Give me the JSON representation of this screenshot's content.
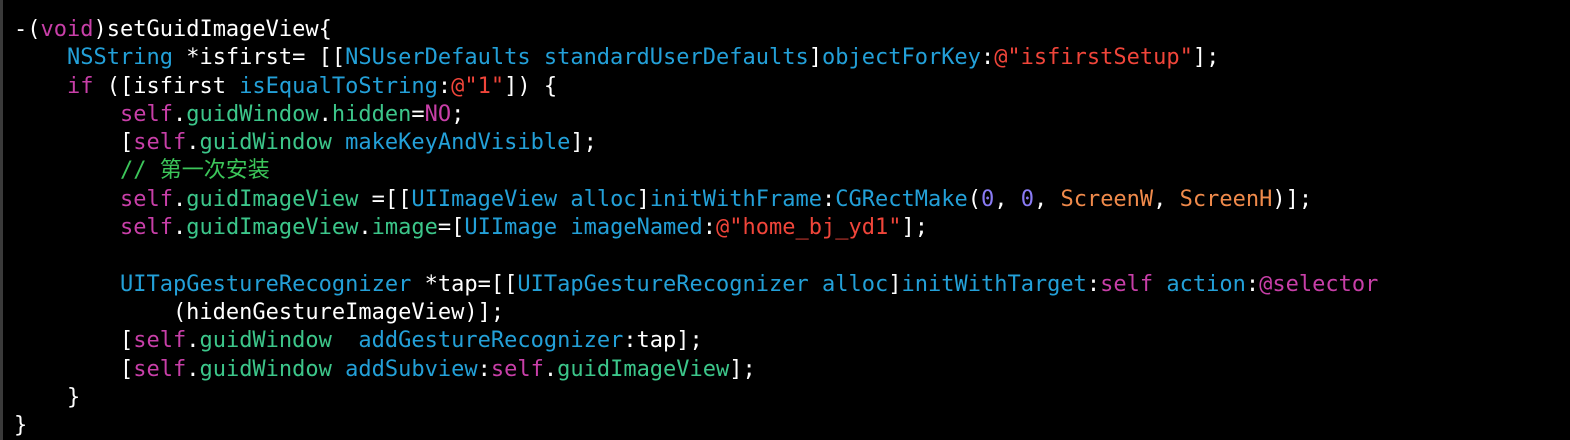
{
  "colors": {
    "background": "#000000",
    "plain": "#ffffff",
    "keyword": "#c83fa8",
    "type": "#23a0d8",
    "property": "#3cc68a",
    "string": "#f0453a",
    "number": "#8a7bf5",
    "macro": "#f08a4b",
    "comment": "#3cc65a"
  },
  "code": {
    "lines": [
      [
        {
          "t": "-(",
          "k": "plain"
        },
        {
          "t": "void",
          "k": "kw"
        },
        {
          "t": ")setGuidImageView{",
          "k": "plain"
        }
      ],
      [
        {
          "t": "    ",
          "k": "plain"
        },
        {
          "t": "NSString",
          "k": "type"
        },
        {
          "t": " *isfirst= [[",
          "k": "plain"
        },
        {
          "t": "NSUserDefaults",
          "k": "type"
        },
        {
          "t": " ",
          "k": "plain"
        },
        {
          "t": "standardUserDefaults",
          "k": "method"
        },
        {
          "t": "]",
          "k": "plain"
        },
        {
          "t": "objectForKey",
          "k": "method"
        },
        {
          "t": ":",
          "k": "plain"
        },
        {
          "t": "@\"isfirstSetup\"",
          "k": "str"
        },
        {
          "t": "];",
          "k": "plain"
        }
      ],
      [
        {
          "t": "    ",
          "k": "plain"
        },
        {
          "t": "if",
          "k": "kw"
        },
        {
          "t": " ([isfirst ",
          "k": "plain"
        },
        {
          "t": "isEqualToString",
          "k": "method"
        },
        {
          "t": ":",
          "k": "plain"
        },
        {
          "t": "@\"1\"",
          "k": "str"
        },
        {
          "t": "]) {",
          "k": "plain"
        }
      ],
      [
        {
          "t": "        ",
          "k": "plain"
        },
        {
          "t": "self",
          "k": "kw"
        },
        {
          "t": ".",
          "k": "plain"
        },
        {
          "t": "guidWindow",
          "k": "prop"
        },
        {
          "t": ".",
          "k": "plain"
        },
        {
          "t": "hidden",
          "k": "prop"
        },
        {
          "t": "=",
          "k": "plain"
        },
        {
          "t": "NO",
          "k": "kw"
        },
        {
          "t": ";",
          "k": "plain"
        }
      ],
      [
        {
          "t": "        [",
          "k": "plain"
        },
        {
          "t": "self",
          "k": "kw"
        },
        {
          "t": ".",
          "k": "plain"
        },
        {
          "t": "guidWindow",
          "k": "prop"
        },
        {
          "t": " ",
          "k": "plain"
        },
        {
          "t": "makeKeyAndVisible",
          "k": "method"
        },
        {
          "t": "];",
          "k": "plain"
        }
      ],
      [
        {
          "t": "        ",
          "k": "plain"
        },
        {
          "t": "// 第一次安装",
          "k": "comment"
        }
      ],
      [
        {
          "t": "        ",
          "k": "plain"
        },
        {
          "t": "self",
          "k": "kw"
        },
        {
          "t": ".",
          "k": "plain"
        },
        {
          "t": "guidImageView",
          "k": "prop"
        },
        {
          "t": " =[[",
          "k": "plain"
        },
        {
          "t": "UIImageView",
          "k": "type"
        },
        {
          "t": " ",
          "k": "plain"
        },
        {
          "t": "alloc",
          "k": "method"
        },
        {
          "t": "]",
          "k": "plain"
        },
        {
          "t": "initWithFrame",
          "k": "method"
        },
        {
          "t": ":",
          "k": "plain"
        },
        {
          "t": "CGRectMake",
          "k": "method"
        },
        {
          "t": "(",
          "k": "plain"
        },
        {
          "t": "0",
          "k": "num"
        },
        {
          "t": ", ",
          "k": "plain"
        },
        {
          "t": "0",
          "k": "num"
        },
        {
          "t": ", ",
          "k": "plain"
        },
        {
          "t": "ScreenW",
          "k": "macro"
        },
        {
          "t": ", ",
          "k": "plain"
        },
        {
          "t": "ScreenH",
          "k": "macro"
        },
        {
          "t": ")];",
          "k": "plain"
        }
      ],
      [
        {
          "t": "        ",
          "k": "plain"
        },
        {
          "t": "self",
          "k": "kw"
        },
        {
          "t": ".",
          "k": "plain"
        },
        {
          "t": "guidImageView",
          "k": "prop"
        },
        {
          "t": ".",
          "k": "plain"
        },
        {
          "t": "image",
          "k": "prop"
        },
        {
          "t": "=[",
          "k": "plain"
        },
        {
          "t": "UIImage",
          "k": "type"
        },
        {
          "t": " ",
          "k": "plain"
        },
        {
          "t": "imageNamed",
          "k": "method"
        },
        {
          "t": ":",
          "k": "plain"
        },
        {
          "t": "@\"home_bj_yd1\"",
          "k": "str"
        },
        {
          "t": "];",
          "k": "plain"
        }
      ],
      [
        {
          "t": "",
          "k": "plain"
        }
      ],
      [
        {
          "t": "        ",
          "k": "plain"
        },
        {
          "t": "UITapGestureRecognizer",
          "k": "type"
        },
        {
          "t": " *tap=[[",
          "k": "plain"
        },
        {
          "t": "UITapGestureRecognizer",
          "k": "type"
        },
        {
          "t": " ",
          "k": "plain"
        },
        {
          "t": "alloc",
          "k": "method"
        },
        {
          "t": "]",
          "k": "plain"
        },
        {
          "t": "initWithTarget",
          "k": "method"
        },
        {
          "t": ":",
          "k": "plain"
        },
        {
          "t": "self",
          "k": "kw"
        },
        {
          "t": " ",
          "k": "plain"
        },
        {
          "t": "action",
          "k": "method"
        },
        {
          "t": ":",
          "k": "plain"
        },
        {
          "t": "@selector",
          "k": "kw"
        }
      ],
      [
        {
          "t": "            (hidenGestureImageView)];",
          "k": "plain"
        }
      ],
      [
        {
          "t": "        [",
          "k": "plain"
        },
        {
          "t": "self",
          "k": "kw"
        },
        {
          "t": ".",
          "k": "plain"
        },
        {
          "t": "guidWindow",
          "k": "prop"
        },
        {
          "t": "  ",
          "k": "plain"
        },
        {
          "t": "addGestureRecognizer",
          "k": "method"
        },
        {
          "t": ":tap];",
          "k": "plain"
        }
      ],
      [
        {
          "t": "        [",
          "k": "plain"
        },
        {
          "t": "self",
          "k": "kw"
        },
        {
          "t": ".",
          "k": "plain"
        },
        {
          "t": "guidWindow",
          "k": "prop"
        },
        {
          "t": " ",
          "k": "plain"
        },
        {
          "t": "addSubview",
          "k": "method"
        },
        {
          "t": ":",
          "k": "plain"
        },
        {
          "t": "self",
          "k": "kw"
        },
        {
          "t": ".",
          "k": "plain"
        },
        {
          "t": "guidImageView",
          "k": "prop"
        },
        {
          "t": "];",
          "k": "plain"
        }
      ],
      [
        {
          "t": "    }",
          "k": "plain"
        }
      ],
      [
        {
          "t": "}",
          "k": "plain"
        }
      ]
    ]
  }
}
